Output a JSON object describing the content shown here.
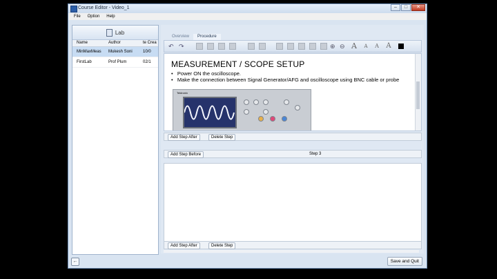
{
  "window": {
    "title": "Course Editor - Video_1",
    "controls": [
      "–",
      "□",
      "✕"
    ]
  },
  "menu": [
    "File",
    "Option",
    "Help"
  ],
  "left": {
    "header": "Lab",
    "columns": [
      "Name",
      "Author",
      "te Crea"
    ],
    "rows": [
      {
        "name": "MinMaxMeas",
        "author": "Mukesh Soni",
        "created": "10/0"
      },
      {
        "name": "FirstLab",
        "author": "Prof Plum",
        "created": "02/1"
      }
    ]
  },
  "tabs": [
    "Overview",
    "Procedure"
  ],
  "toolbar": {
    "icons": [
      "undo-icon",
      "redo-icon",
      "cut-icon",
      "copy-icon",
      "paste-icon",
      "bold-icon",
      "list-icon",
      "align-left-icon",
      "align-center-icon",
      "align-right-icon",
      "table-icon",
      "image-icon",
      "zoom-in-icon",
      "zoom-out-icon"
    ],
    "text_buttons": [
      "A",
      "A",
      "A",
      "A"
    ],
    "color_swatch": "#000000"
  },
  "content": {
    "heading": "MEASUREMENT / SCOPE SETUP",
    "bullets": [
      "Power ON the oscilloscope.",
      "Make the connection between Signal Generator/AFG and oscilloscope using BNC cable or probe"
    ],
    "scope_brand": "Tektronix"
  },
  "steps": {
    "add_after": "Add Step After",
    "delete": "Delete Step",
    "add_before": "Add Step Before",
    "step_label": "Step 3"
  },
  "footer": {
    "save_quit": "Save and Quit"
  }
}
